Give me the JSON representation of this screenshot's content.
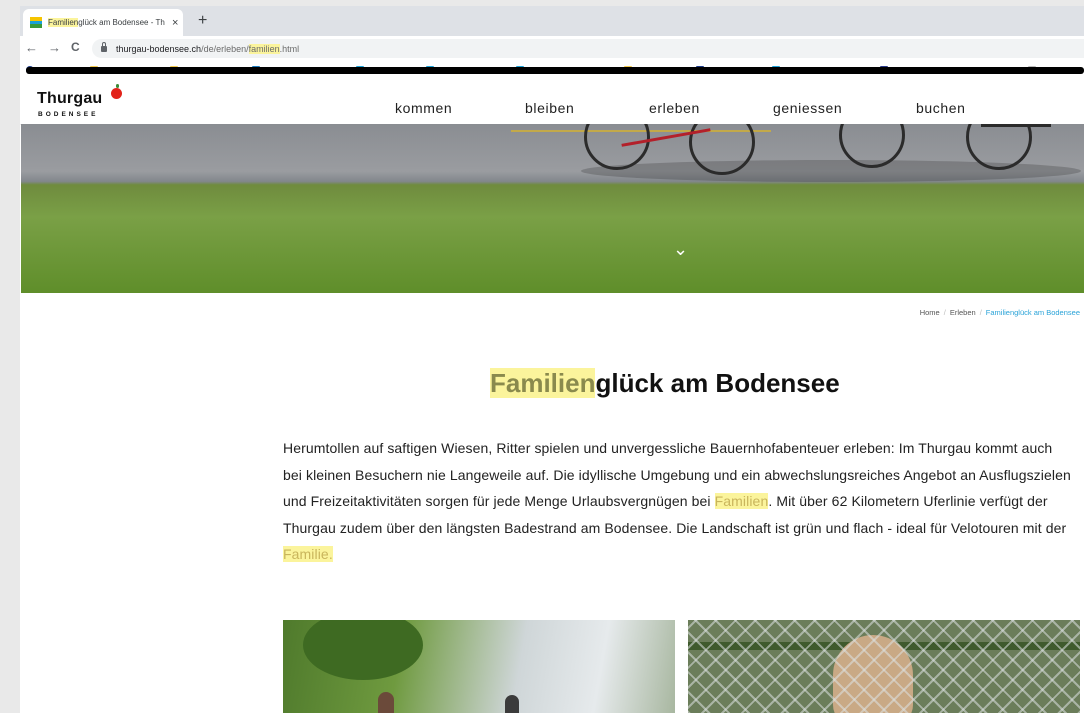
{
  "browser": {
    "tab_title_highlight": "Familien",
    "tab_title_rest": "glück am Bodensee - Th",
    "tab_close": "×",
    "new_tab": "+",
    "nav_back": "←",
    "nav_forward": "→",
    "nav_reload": "C",
    "url_main": "thurgau-bodensee.ch",
    "url_path": "/de/erleben/",
    "url_highlight": "familien",
    "url_ext": ".html"
  },
  "site": {
    "logo": "Thurgau",
    "logo_sub": "BODENSEE",
    "nav": [
      "kommen",
      "bleiben",
      "erleben",
      "geniessen",
      "buchen"
    ],
    "scroll_chevron": "⌄"
  },
  "breadcrumb": {
    "home": "Home",
    "sep": "/",
    "section": "Erleben",
    "current": "Familienglück am Bodensee"
  },
  "page": {
    "title_highlight": "Familien",
    "title_rest": "glück am Bodensee",
    "intro_part1": "Herumtollen auf saftigen Wiesen, Ritter spielen und unvergessliche Bauernhofabenteuer erleben: Im Thurgau kommt auch bei kleinen Besuchern nie Langeweile auf. Die idyllische Umgebung und ein abwechslungsreiches Angebot an Ausflugszielen und Freizeitaktivitäten sorgen für jede Menge Urlaubsvergnügen bei ",
    "intro_highlight1": "Familien",
    "intro_part2": ". Mit über 62 Kilometern Uferlinie verfügt der Thurgau zudem über den längsten Badestrand am Bodensee. Die Landschaft ist grün und flach - ideal für Velotouren mit der ",
    "intro_highlight2": "Familie.",
    "highlight_color": "#fbf49c",
    "link_color": "#2aa3d8"
  }
}
